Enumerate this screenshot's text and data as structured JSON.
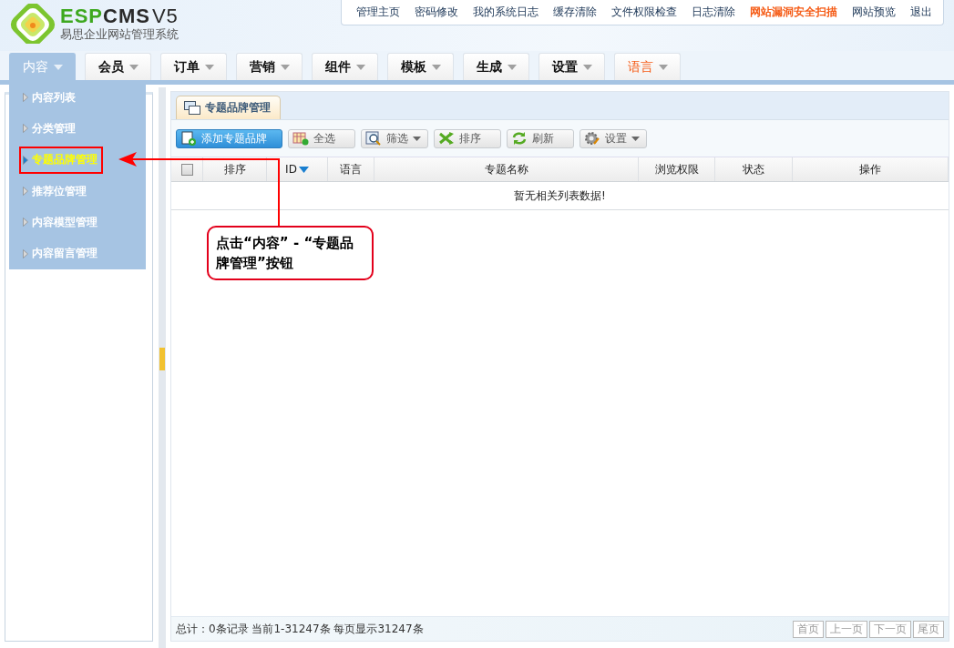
{
  "logo": {
    "brand_a": "ESP",
    "brand_b": "CMS",
    "version": "V5",
    "subtitle": "易思企业网站管理系统"
  },
  "top_links": [
    {
      "label": "管理主页",
      "highlight": false
    },
    {
      "label": "密码修改",
      "highlight": false
    },
    {
      "label": "我的系统日志",
      "highlight": false
    },
    {
      "label": "缓存清除",
      "highlight": false
    },
    {
      "label": "文件权限检查",
      "highlight": false
    },
    {
      "label": "日志清除",
      "highlight": false
    },
    {
      "label": "网站漏洞安全扫描",
      "highlight": true
    },
    {
      "label": "网站预览",
      "highlight": false
    },
    {
      "label": "退出",
      "highlight": false
    }
  ],
  "nav_tabs": [
    {
      "label": "内容",
      "selected": true,
      "highlight": false
    },
    {
      "label": "会员",
      "selected": false,
      "highlight": false
    },
    {
      "label": "订单",
      "selected": false,
      "highlight": false
    },
    {
      "label": "营销",
      "selected": false,
      "highlight": false
    },
    {
      "label": "组件",
      "selected": false,
      "highlight": false
    },
    {
      "label": "模板",
      "selected": false,
      "highlight": false
    },
    {
      "label": "生成",
      "selected": false,
      "highlight": false
    },
    {
      "label": "设置",
      "selected": false,
      "highlight": false
    },
    {
      "label": "语言",
      "selected": false,
      "highlight": true
    }
  ],
  "menu": [
    {
      "label": "内容列表",
      "selected": false
    },
    {
      "label": "分类管理",
      "selected": false
    },
    {
      "label": "专题品牌管理",
      "selected": true
    },
    {
      "label": "推荐位管理",
      "selected": false
    },
    {
      "label": "内容模型管理",
      "selected": false
    },
    {
      "label": "内容留言管理",
      "selected": false
    }
  ],
  "panel_tab": {
    "label": "专题品牌管理"
  },
  "toolbar": [
    {
      "label": "添加专题品牌",
      "kind": "add",
      "dropdown": false
    },
    {
      "label": "全选",
      "kind": "select",
      "dropdown": false
    },
    {
      "label": "筛选",
      "kind": "filter",
      "dropdown": true
    },
    {
      "label": "排序",
      "kind": "sort",
      "dropdown": false
    },
    {
      "label": "刷新",
      "kind": "refresh",
      "dropdown": false
    },
    {
      "label": "设置",
      "kind": "settings",
      "dropdown": true
    }
  ],
  "table": {
    "columns": [
      {
        "kind": "checkbox",
        "checked": false
      },
      {
        "kind": "text",
        "label": "排序"
      },
      {
        "kind": "sorted",
        "label": "ID"
      },
      {
        "kind": "text",
        "label": "语言"
      },
      {
        "kind": "text",
        "label": "专题名称"
      },
      {
        "kind": "text",
        "label": "浏览权限"
      },
      {
        "kind": "text",
        "label": "状态"
      },
      {
        "kind": "text",
        "label": "操作"
      }
    ],
    "empty_message": "暂无相关列表数据!"
  },
  "status_bar": {
    "summary": "总计：0条记录 当前1-31247条 每页显示31247条",
    "pager": [
      "首页",
      "上一页",
      "下一页",
      "尾页"
    ]
  },
  "annotation": {
    "callout": "点击“内容” - “专题品牌管理”按钮"
  }
}
